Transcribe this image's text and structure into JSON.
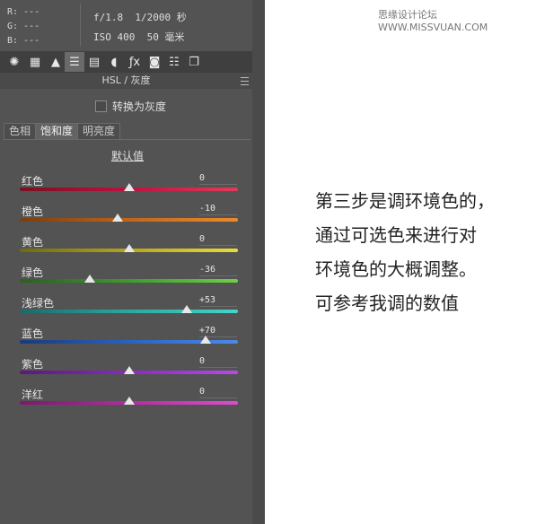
{
  "info": {
    "r": "R: ---",
    "g": "G: ---",
    "b": "B: ---",
    "camera_line1": "f/1.8  1/2000 秒",
    "camera_line2": "ISO 400  50 毫米"
  },
  "toolbar": {
    "icons": [
      "aperture-icon",
      "grid-icon",
      "mountains-icon",
      "hsl-icon",
      "split-icon",
      "lens-icon",
      "fx-icon",
      "camera-icon",
      "sliders-icon",
      "presets-icon"
    ],
    "glyphs": [
      "✺",
      "▦",
      "▲",
      "☰",
      "▤",
      "◖",
      "ƒx",
      "◙",
      "☷",
      "❐"
    ]
  },
  "panel_title": "HSL / 灰度",
  "convert_grayscale": "转换为灰度",
  "tabs": [
    "色相",
    "饱和度",
    "明亮度"
  ],
  "active_tab": "饱和度",
  "default_label": "默认值",
  "sliders": [
    {
      "label": "红色",
      "value": "0",
      "level": 0,
      "colors": [
        "#7a1020",
        "#c01040",
        "#e33a5a"
      ]
    },
    {
      "label": "橙色",
      "value": "-10",
      "level": -10,
      "colors": [
        "#7a3d10",
        "#c0651a",
        "#ef8a2a"
      ]
    },
    {
      "label": "黄色",
      "value": "0",
      "level": 0,
      "colors": [
        "#6f6a10",
        "#b5a51c",
        "#e8dd3a"
      ]
    },
    {
      "label": "绿色",
      "value": "-36",
      "level": -36,
      "colors": [
        "#2a6020",
        "#3f9a2e",
        "#6dd043"
      ]
    },
    {
      "label": "浅绿色",
      "value": "+53",
      "level": 53,
      "colors": [
        "#1a6a6a",
        "#2ba8a0",
        "#45d6c8"
      ]
    },
    {
      "label": "蓝色",
      "value": "+70",
      "level": 70,
      "colors": [
        "#1a3a7a",
        "#2a62c0",
        "#4b8be8"
      ]
    },
    {
      "label": "紫色",
      "value": "0",
      "level": 0,
      "colors": [
        "#5a1a7a",
        "#8a2ac0",
        "#b54be8"
      ]
    },
    {
      "label": "洋红",
      "value": "0",
      "level": 0,
      "colors": [
        "#7a1a6a",
        "#b52aa5",
        "#e04bd0"
      ]
    }
  ],
  "note_lines": [
    "第三步是调环境色的，",
    "通过可选色来进行对",
    "环境色的大概调整。",
    "可参考我调的数值"
  ],
  "watermark": "思缘设计论坛 WWW.MISSVUAN.COM"
}
